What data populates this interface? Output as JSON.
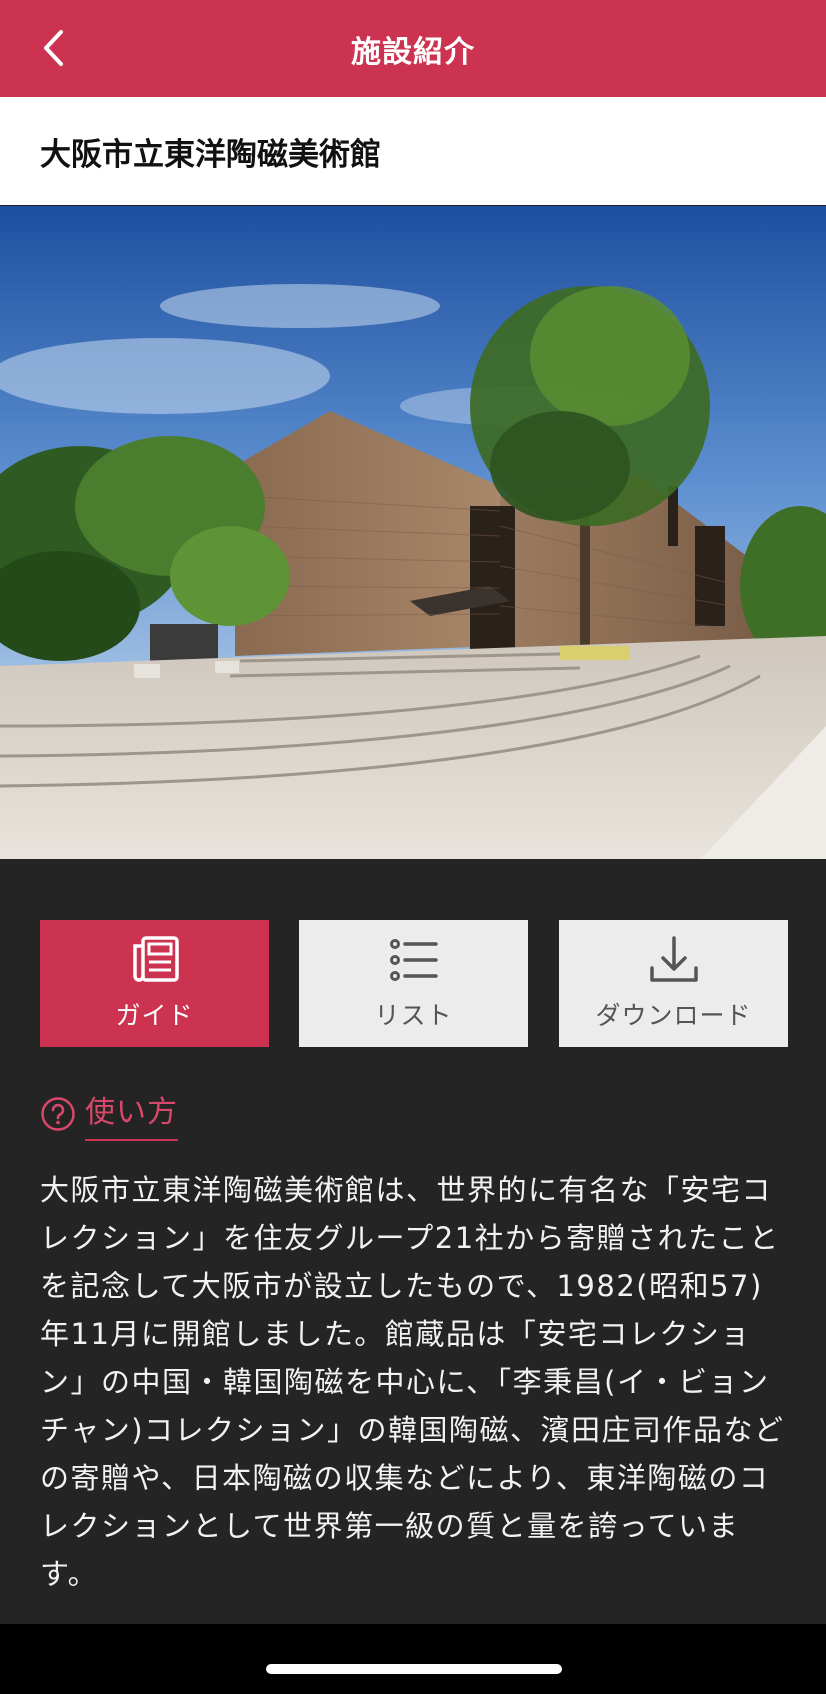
{
  "header": {
    "title": "施設紹介"
  },
  "facility": {
    "name": "大阪市立東洋陶磁美術館"
  },
  "tabs": [
    {
      "label": "ガイド",
      "icon": "newspaper-icon",
      "active": true
    },
    {
      "label": "リスト",
      "icon": "list-icon",
      "active": false
    },
    {
      "label": "ダウンロード",
      "icon": "download-icon",
      "active": false
    }
  ],
  "howto": {
    "icon": "question-circle-icon",
    "label": "使い方"
  },
  "description": "大阪市立東洋陶磁美術館は、世界的に有名な「安宅コレクション」を住友グループ21社から寄贈されたことを記念して大阪市が設立したもので、1982(昭和57)年11月に開館しました。館蔵品は「安宅コレクション」の中国・韓国陶磁を中心に、「李秉昌(イ・ビョンチャン)コレクション」の韓国陶磁、濱田庄司作品などの寄贈や、日本陶磁の収集などにより、東洋陶磁のコレクションとして世界第一級の質と量を誇っています。",
  "colors": {
    "accent": "#cc3350",
    "background": "#242424",
    "tab_inactive": "#ececec"
  }
}
